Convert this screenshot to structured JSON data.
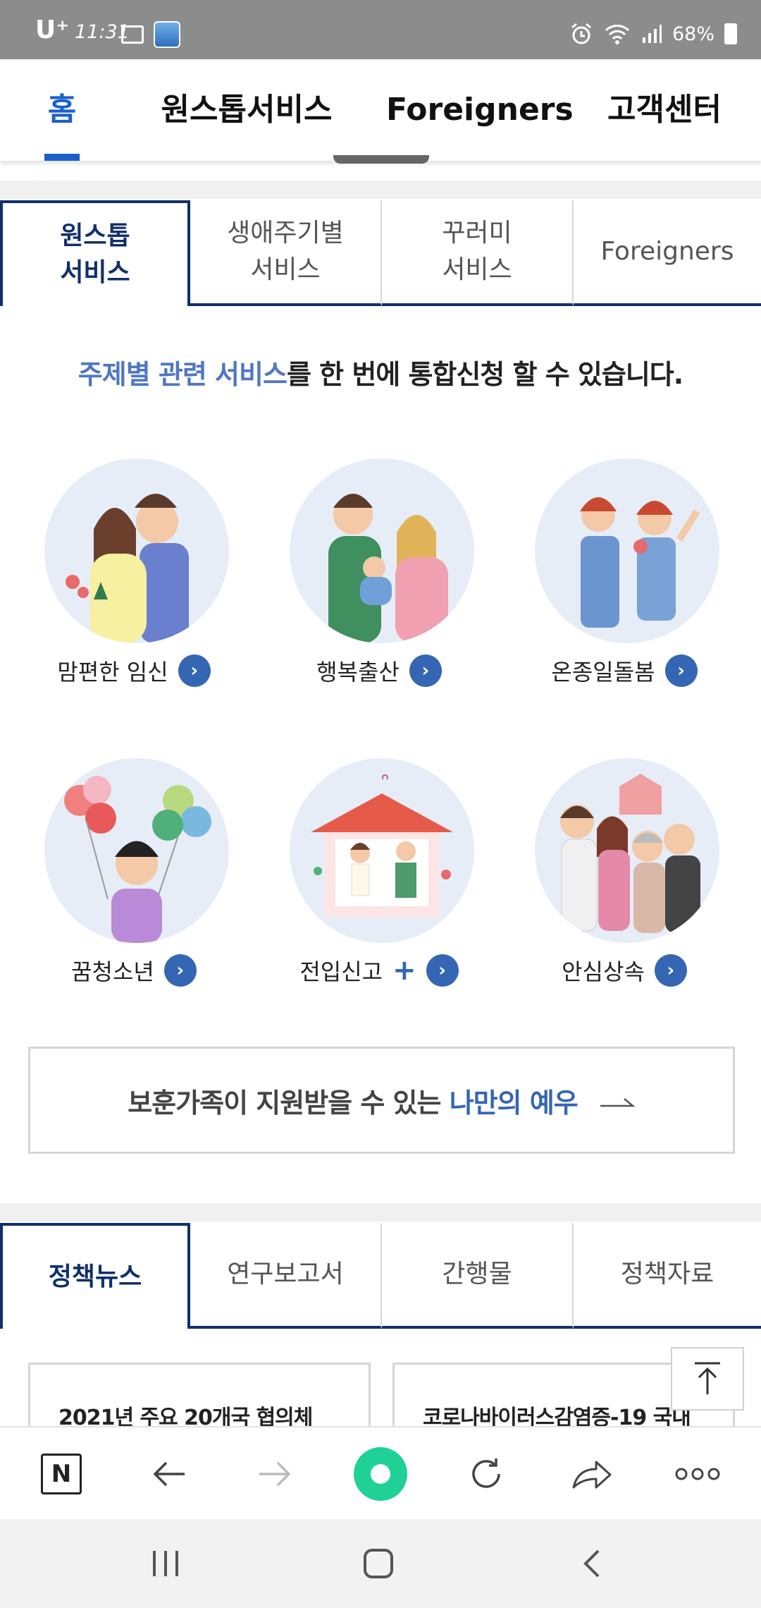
{
  "status_bar": {
    "carrier": "U⁺",
    "time": "11:31",
    "battery": "68%"
  },
  "top_nav": {
    "tabs": [
      {
        "label": "홈",
        "active": true
      },
      {
        "label": "원스톱서비스",
        "active": false
      },
      {
        "label": "Foreigners",
        "active": false
      },
      {
        "label": "고객센터",
        "active": false
      }
    ]
  },
  "service_tabs": [
    {
      "line1": "원스톱",
      "line2": "서비스",
      "active": true
    },
    {
      "line1": "생애주기별",
      "line2": "서비스",
      "active": false
    },
    {
      "line1": "꾸러미",
      "line2": "서비스",
      "active": false
    },
    {
      "line1": "Foreigners",
      "line2": "",
      "active": false
    }
  ],
  "intro": {
    "highlight": "주제별 관련 서비스",
    "rest": "를 한 번에 통합신청 할 수 있습니다."
  },
  "services": [
    {
      "label": "맘편한 임신",
      "icon": "pregnancy-illustration"
    },
    {
      "label": "행복출산",
      "icon": "childbirth-illustration"
    },
    {
      "label": "온종일돌봄",
      "icon": "childcare-illustration"
    },
    {
      "label": "꿈청소년",
      "icon": "youth-illustration"
    },
    {
      "label": "전입신고",
      "icon": "move-in-illustration",
      "extra": "+"
    },
    {
      "label": "안심상속",
      "icon": "inheritance-illustration"
    }
  ],
  "veterans": {
    "text": "보훈가족이 지원받을 수 있는 ",
    "highlight": "나만의 예우",
    "arrow": "→"
  },
  "policy_tabs": [
    {
      "label": "정책뉴스",
      "active": true
    },
    {
      "label": "연구보고서",
      "active": false
    },
    {
      "label": "간행물",
      "active": false
    },
    {
      "label": "정책자료",
      "active": false
    }
  ],
  "news_cards": [
    {
      "title": "2021년 주요 20개국 협의체"
    },
    {
      "title": "코로나바이러스감염증-19 국내"
    }
  ],
  "browser_toolbar": {
    "home_label": "N",
    "buttons": [
      "naver-home-icon",
      "back-icon",
      "forward-icon",
      "green-dot-icon",
      "refresh-icon",
      "share-icon",
      "more-icon"
    ]
  },
  "colors": {
    "accent": "#1b5fcc",
    "navy": "#10306a",
    "go_button": "#3566b3",
    "highlight_text": "#4f77c4"
  }
}
